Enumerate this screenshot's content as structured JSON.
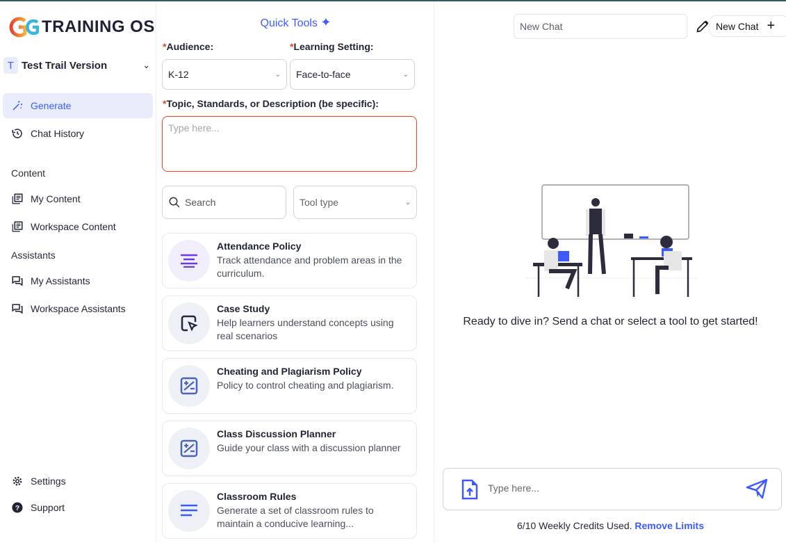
{
  "brand": {
    "name": "TRAINING OS"
  },
  "workspace": {
    "initial": "T",
    "name": "Test Trail Version"
  },
  "sidebar": {
    "nav": [
      {
        "label": "Generate",
        "icon": "magic-wand-icon",
        "active": true
      },
      {
        "label": "Chat History",
        "icon": "history-icon"
      }
    ],
    "content_heading": "Content",
    "content": [
      {
        "label": "My Content",
        "icon": "library-icon"
      },
      {
        "label": "Workspace Content",
        "icon": "library-icon"
      }
    ],
    "assistants_heading": "Assistants",
    "assistants": [
      {
        "label": "My Assistants",
        "icon": "chat-icon"
      },
      {
        "label": "Workspace Assistants",
        "icon": "chat-icon"
      }
    ],
    "bottom": [
      {
        "label": "Settings",
        "icon": "gear-icon"
      },
      {
        "label": "Support",
        "icon": "help-icon"
      }
    ]
  },
  "tools": {
    "title": "Quick Tools",
    "audience_label": "Audience:",
    "audience_value": "K-12",
    "setting_label": "Learning Setting:",
    "setting_value": "Face-to-face",
    "topic_label": "Topic, Standards, or Description (be specific):",
    "topic_placeholder": "Type here...",
    "search_placeholder": "Search",
    "tooltype_placeholder": "Tool type",
    "cards": [
      {
        "title": "Attendance Policy",
        "desc": "Track attendance and problem areas in the curriculum.",
        "icon": "align-center-icon"
      },
      {
        "title": "Case Study",
        "desc": "Help learners understand concepts using real scenarios",
        "icon": "cursor-box-icon"
      },
      {
        "title": "Cheating and Plagiarism Policy",
        "desc": "Policy to control cheating and plagiarism.",
        "icon": "plus-minus-box-icon"
      },
      {
        "title": "Class Discussion Planner",
        "desc": "Guide your class with a discussion planner",
        "icon": "plus-minus-box-icon"
      },
      {
        "title": "Classroom Rules",
        "desc": "Generate a set of classroom rules to maintain a conducive learning...",
        "icon": "align-left-icon"
      }
    ]
  },
  "chat": {
    "title_placeholder": "New Chat",
    "new_chat_label": "New Chat",
    "empty_message": "Ready to dive in? Send a chat or select a tool to get started!",
    "input_placeholder": "Type here...",
    "credits_text": "6/10 Weekly Credits Used.",
    "remove_limits": "Remove Limits"
  },
  "colors": {
    "accent": "#3d5afe",
    "required": "#e5461c"
  }
}
